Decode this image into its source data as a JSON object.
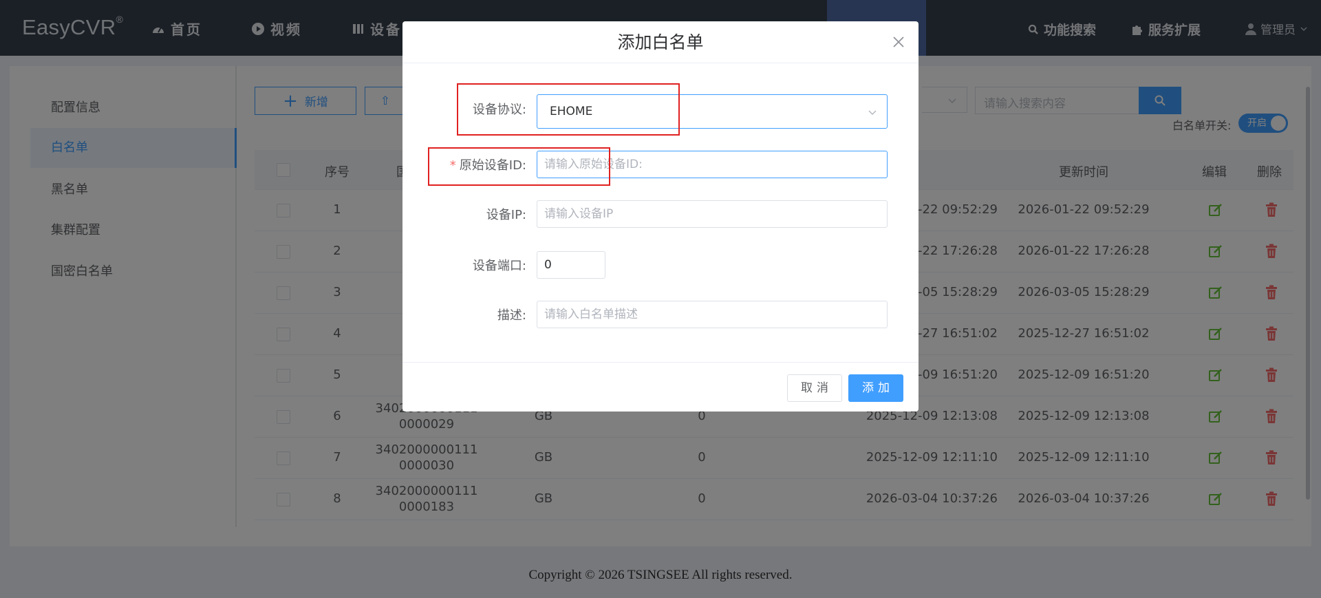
{
  "app": {
    "brand": "EasyCVR",
    "brand_mark": "®"
  },
  "nav": {
    "items": [
      {
        "label": "首页",
        "icon": "dashboard-icon"
      },
      {
        "label": "视频",
        "icon": "play-circle-icon"
      },
      {
        "label": "设备",
        "icon": "device-icon"
      }
    ],
    "right": [
      {
        "label": "功能搜索",
        "icon": "search-icon"
      },
      {
        "label": "服务扩展",
        "icon": "puzzle-icon"
      }
    ],
    "user": "管理员"
  },
  "sidebar": {
    "items": [
      {
        "label": "配置信息",
        "active": false
      },
      {
        "label": "白名单",
        "active": true
      },
      {
        "label": "黑名单",
        "active": false
      },
      {
        "label": "集群配置",
        "active": false
      },
      {
        "label": "国密白名单",
        "active": false
      }
    ]
  },
  "toolbar": {
    "add_label": "新增",
    "search_placeholder": "请输入搜索内容",
    "whitelist_switch_label": "白名单开关:",
    "whitelist_switch_state": "开启"
  },
  "table": {
    "headers": {
      "index": "序号",
      "device_id": "国",
      "created": "",
      "updated": "更新时间",
      "edit": "编辑",
      "delete": "删除"
    },
    "rows": [
      {
        "index": "1",
        "id_a": "340",
        "id_b": "",
        "protocol": "",
        "port": "",
        "created": "-22 09:52:29",
        "updated": "2026-01-22 09:52:29"
      },
      {
        "index": "2",
        "id_a": "340",
        "id_b": "",
        "protocol": "",
        "port": "",
        "created": "-22 17:26:28",
        "updated": "2026-01-22 17:26:28"
      },
      {
        "index": "3",
        "id_a": "340",
        "id_b": "",
        "protocol": "",
        "port": "",
        "created": "-05 15:28:29",
        "updated": "2026-03-05 15:28:29"
      },
      {
        "index": "4",
        "id_a": "340",
        "id_b": "",
        "protocol": "",
        "port": "",
        "created": "-27 16:51:02",
        "updated": "2025-12-27 16:51:02"
      },
      {
        "index": "5",
        "id_a": "340",
        "id_b": "",
        "protocol": "",
        "port": "",
        "created": "-09 16:51:20",
        "updated": "2025-12-09 16:51:20"
      },
      {
        "index": "6",
        "id_a": "3402000000111",
        "id_b": "0000029",
        "protocol": "GB",
        "port": "0",
        "created": "2025-12-09 12:13:08",
        "updated": "2025-12-09 12:13:08"
      },
      {
        "index": "7",
        "id_a": "3402000000111",
        "id_b": "0000030",
        "protocol": "GB",
        "port": "0",
        "created": "2025-12-09 12:11:10",
        "updated": "2025-12-09 12:11:10"
      },
      {
        "index": "8",
        "id_a": "3402000000111",
        "id_b": "0000183",
        "protocol": "GB",
        "port": "0",
        "created": "2026-03-04 10:37:26",
        "updated": "2026-03-04 10:37:26"
      }
    ]
  },
  "footer": {
    "copyright": "Copyright © 2026 TSINGSEE All rights reserved."
  },
  "dialog": {
    "title": "添加白名单",
    "fields": {
      "protocol": {
        "label": "设备协议:",
        "value": "EHOME"
      },
      "origin_id": {
        "label": "原始设备ID:",
        "required_mark": "*",
        "placeholder": "请输入原始设备ID:"
      },
      "ip": {
        "label": "设备IP:",
        "placeholder": "请输入设备IP"
      },
      "port": {
        "label": "设备端口:",
        "value": "0"
      },
      "desc": {
        "label": "描述:",
        "placeholder": "请输入白名单描述"
      }
    },
    "cancel_label": "取消",
    "confirm_label": "添加"
  },
  "colors": {
    "primary": "#409eff",
    "topbar": "#36414e",
    "highlight": "#e02020",
    "edit": "#67c23a",
    "delete": "#f56c6c"
  }
}
